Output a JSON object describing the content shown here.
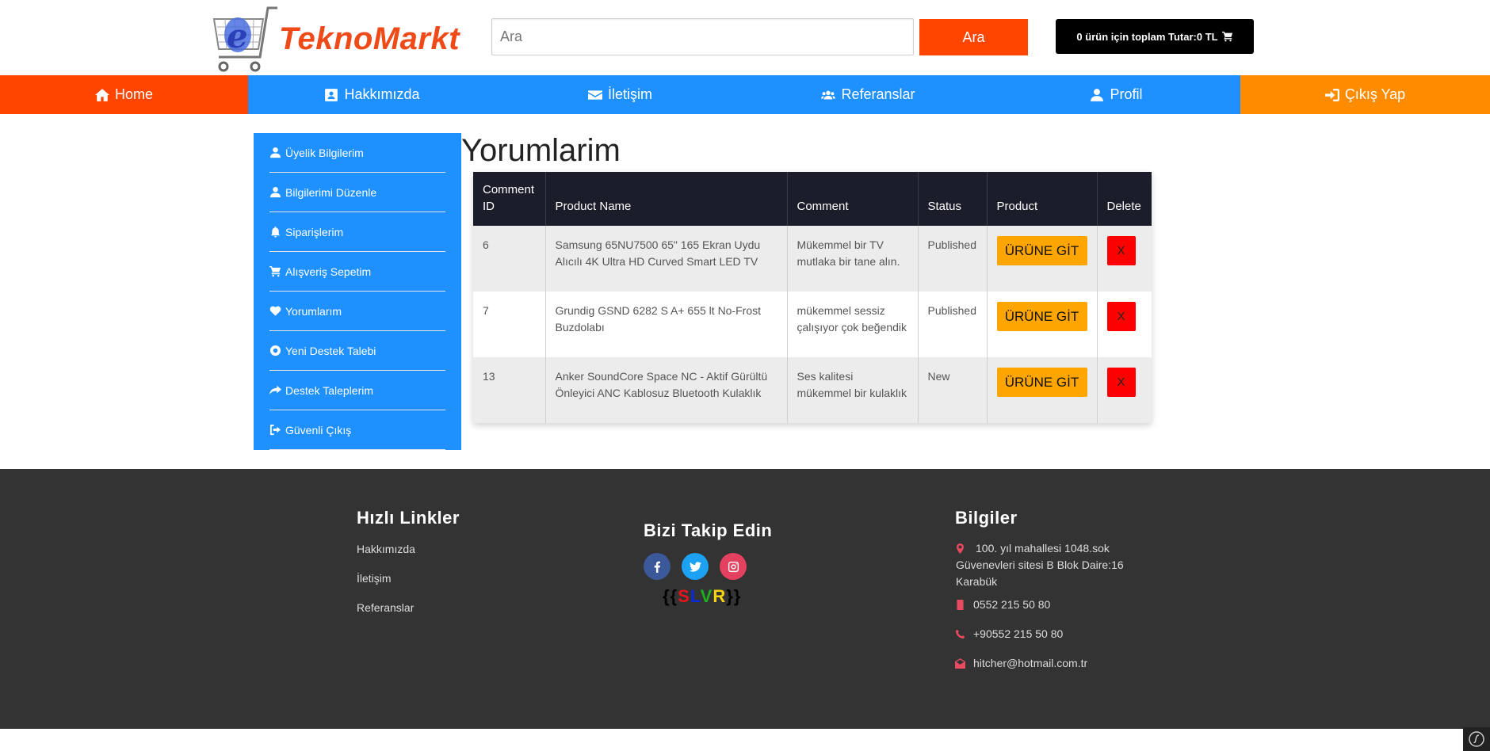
{
  "header": {
    "logo_text": "TeknoMarkt",
    "logo_letter": "e",
    "search_placeholder": "Ara",
    "search_button": "Ara",
    "cart_summary": "0 ürün için toplam Tutar:0 TL"
  },
  "nav": {
    "home": "Home",
    "about": "Hakkımızda",
    "contact": "İletişim",
    "references": "Referanslar",
    "profile": "Profil",
    "logout": "Çıkış Yap"
  },
  "sidebar": {
    "items": [
      {
        "label": "Üyelik Bilgilerim",
        "icon": "user-icon"
      },
      {
        "label": "Bilgilerimi Düzenle",
        "icon": "user-icon"
      },
      {
        "label": "Siparişlerim",
        "icon": "bell-icon"
      },
      {
        "label": "Alışveriş Sepetim",
        "icon": "cart-icon"
      },
      {
        "label": "Yorumlarım",
        "icon": "heart-icon"
      },
      {
        "label": "Yeni Destek Talebi",
        "icon": "lifebuoy-icon"
      },
      {
        "label": "Destek Taleplerim",
        "icon": "share-icon"
      },
      {
        "label": "Güvenli Çıkış",
        "icon": "sign-out-icon"
      }
    ]
  },
  "main": {
    "title": "Yorumlarim",
    "columns": [
      "Comment ID",
      "Product Name",
      "Comment",
      "Status",
      "Product",
      "Delete"
    ],
    "rows": [
      {
        "id": "6",
        "product": "Samsung 65NU7500 65\" 165 Ekran Uydu Alıcılı 4K Ultra HD Curved Smart LED TV",
        "comment": "Mükemmel bir TV mutlaka bir tane alın.",
        "status": "Published",
        "go": "ÜRÜNE GİT",
        "delete": "X"
      },
      {
        "id": "7",
        "product": "Grundig GSND 6282 S A+ 655 lt No-Frost Buzdolabı",
        "comment": "mükemmel sessiz çalışıyor çok beğendik",
        "status": "Published",
        "go": "ÜRÜNE GİT",
        "delete": "X"
      },
      {
        "id": "13",
        "product": "Anker SoundCore Space NC - Aktif Gürültü Önleyici ANC Kablosuz Bluetooth Kulaklık",
        "comment": "Ses kalitesi mükemmel bir kulaklık",
        "status": "New",
        "go": "ÜRÜNE GİT",
        "delete": "X"
      }
    ]
  },
  "footer": {
    "quick_links_title": "Hızlı Linkler",
    "quick_links": [
      "Hakkımızda",
      "İletişim",
      "Referanslar"
    ],
    "follow_title": "Bizi Takip Edin",
    "slvr_open": "{{",
    "slvr_letters": [
      "S",
      "L",
      "V",
      "R"
    ],
    "slvr_close": "}}",
    "info_title": "Bilgiler",
    "address": "100. yıl mahallesi 1048.sok Güvenevleri sitesi B Blok Daire:16 Karabük",
    "mobile": "0552 215 50 80",
    "phone": "+90552 215 50 80",
    "email": "hitcher@hotmail.com.tr"
  },
  "colors": {
    "brand_orange": "#f04a18",
    "nav_home": "#ff4500",
    "nav_blue": "#1e90ff",
    "nav_logout": "#ff8c00",
    "go_button": "#ffa500",
    "delete_button": "#ff0000",
    "footer_bg": "#333333",
    "facebook": "#3b5998",
    "twitter": "#1da1f2",
    "instagram": "#e4405f",
    "slvr_s": "#e8141c",
    "slvr_l": "#0a29d8",
    "slvr_v": "#1db21d",
    "slvr_r": "#f5d40c"
  }
}
